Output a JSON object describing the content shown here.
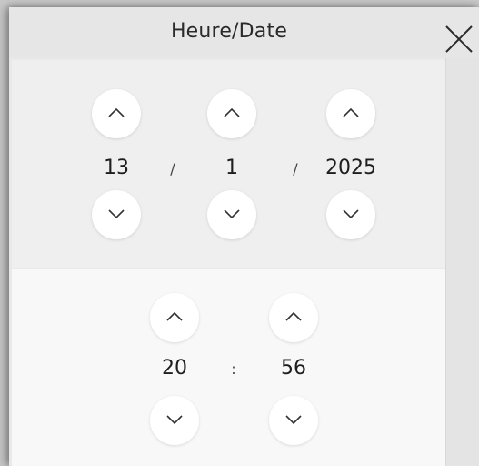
{
  "dialog": {
    "title": "Heure/Date",
    "close_icon": "close-icon"
  },
  "date": {
    "day": "13",
    "month": "1",
    "year": "2025",
    "separator_1": "/",
    "separator_2": "/"
  },
  "time": {
    "hour": "20",
    "minute": "56",
    "separator": ":"
  },
  "icons": {
    "up": "chevron-up-icon",
    "down": "chevron-down-icon"
  }
}
